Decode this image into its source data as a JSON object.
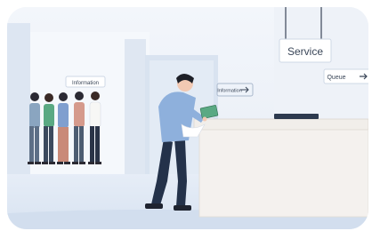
{
  "signs": {
    "service": "Service",
    "queue": "Queue",
    "information": "Information",
    "information_door": "Information"
  },
  "colors": {
    "background": "#e9eff7",
    "counter": "#f4f1ee",
    "shirt": "#8eb0dc",
    "pants": "#24324a",
    "accent_green": "#5aa983"
  }
}
